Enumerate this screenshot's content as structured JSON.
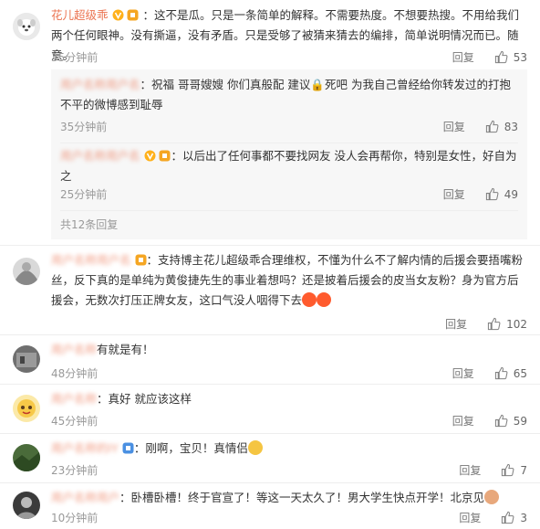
{
  "colors": {
    "username": "#eb7350",
    "text": "#333333",
    "meta": "#999999",
    "separator": "#eeeeee",
    "subbg": "#f7f7f7"
  },
  "icons": {
    "like": "thumbs-up-icon",
    "verified": "v-badge-icon",
    "fan": "fan-badge-icon"
  },
  "comments": [
    {
      "author": "花儿超级乖",
      "text": "：这不是瓜。只是一条简单的解释。不需要热度。不想要热搜。不用给我们两个任何眼神。没有撕逼，没有矛盾。只是受够了被猜来猜去的编排，简单说明情况而已。随意。",
      "time": "35分钟前",
      "reply": "回复",
      "likes": "53"
    },
    {
      "author": "",
      "text": "：祝福 哥哥嫂嫂 你们真般配 建议🔒死吧 为我自己曾经给你转发过的打抱不平的微博感到耻辱",
      "time": "35分钟前",
      "reply": "回复",
      "likes": "83"
    },
    {
      "author": "",
      "text": "：以后出了任何事都不要找网友 没人会再帮你，特别是女性，好自为之",
      "time": "25分钟前",
      "reply": "回复",
      "likes": "49"
    },
    {
      "more": "共12条回复"
    },
    {
      "author": "",
      "text": "：支持博主花儿超级乖合理维权，不懂为什么不了解内情的后援会要捂嘴粉丝，反下真的是单纯为黄俊捷先生的事业着想吗？还是披着后援会的皮当女友粉？身为官方后援会，无数次打压正牌女友，这口气没人咽得下去",
      "time": "",
      "reply": "回复",
      "likes": "102"
    },
    {
      "author": "",
      "text": "有就是有！",
      "time": "48分钟前",
      "reply": "回复",
      "likes": "65"
    },
    {
      "author": "",
      "text": "：真好 就应该这样",
      "time": "45分钟前",
      "reply": "回复",
      "likes": "59"
    },
    {
      "author": "",
      "text": "：刚啊，宝贝！真情侣",
      "time": "23分钟前",
      "reply": "回复",
      "likes": "7"
    },
    {
      "author": "",
      "text": "：卧槽卧槽！终于官宣了！等这一天太久了！男大学生快点开学！北京见",
      "time": "10分钟前",
      "reply": "回复",
      "likes": "3"
    }
  ]
}
